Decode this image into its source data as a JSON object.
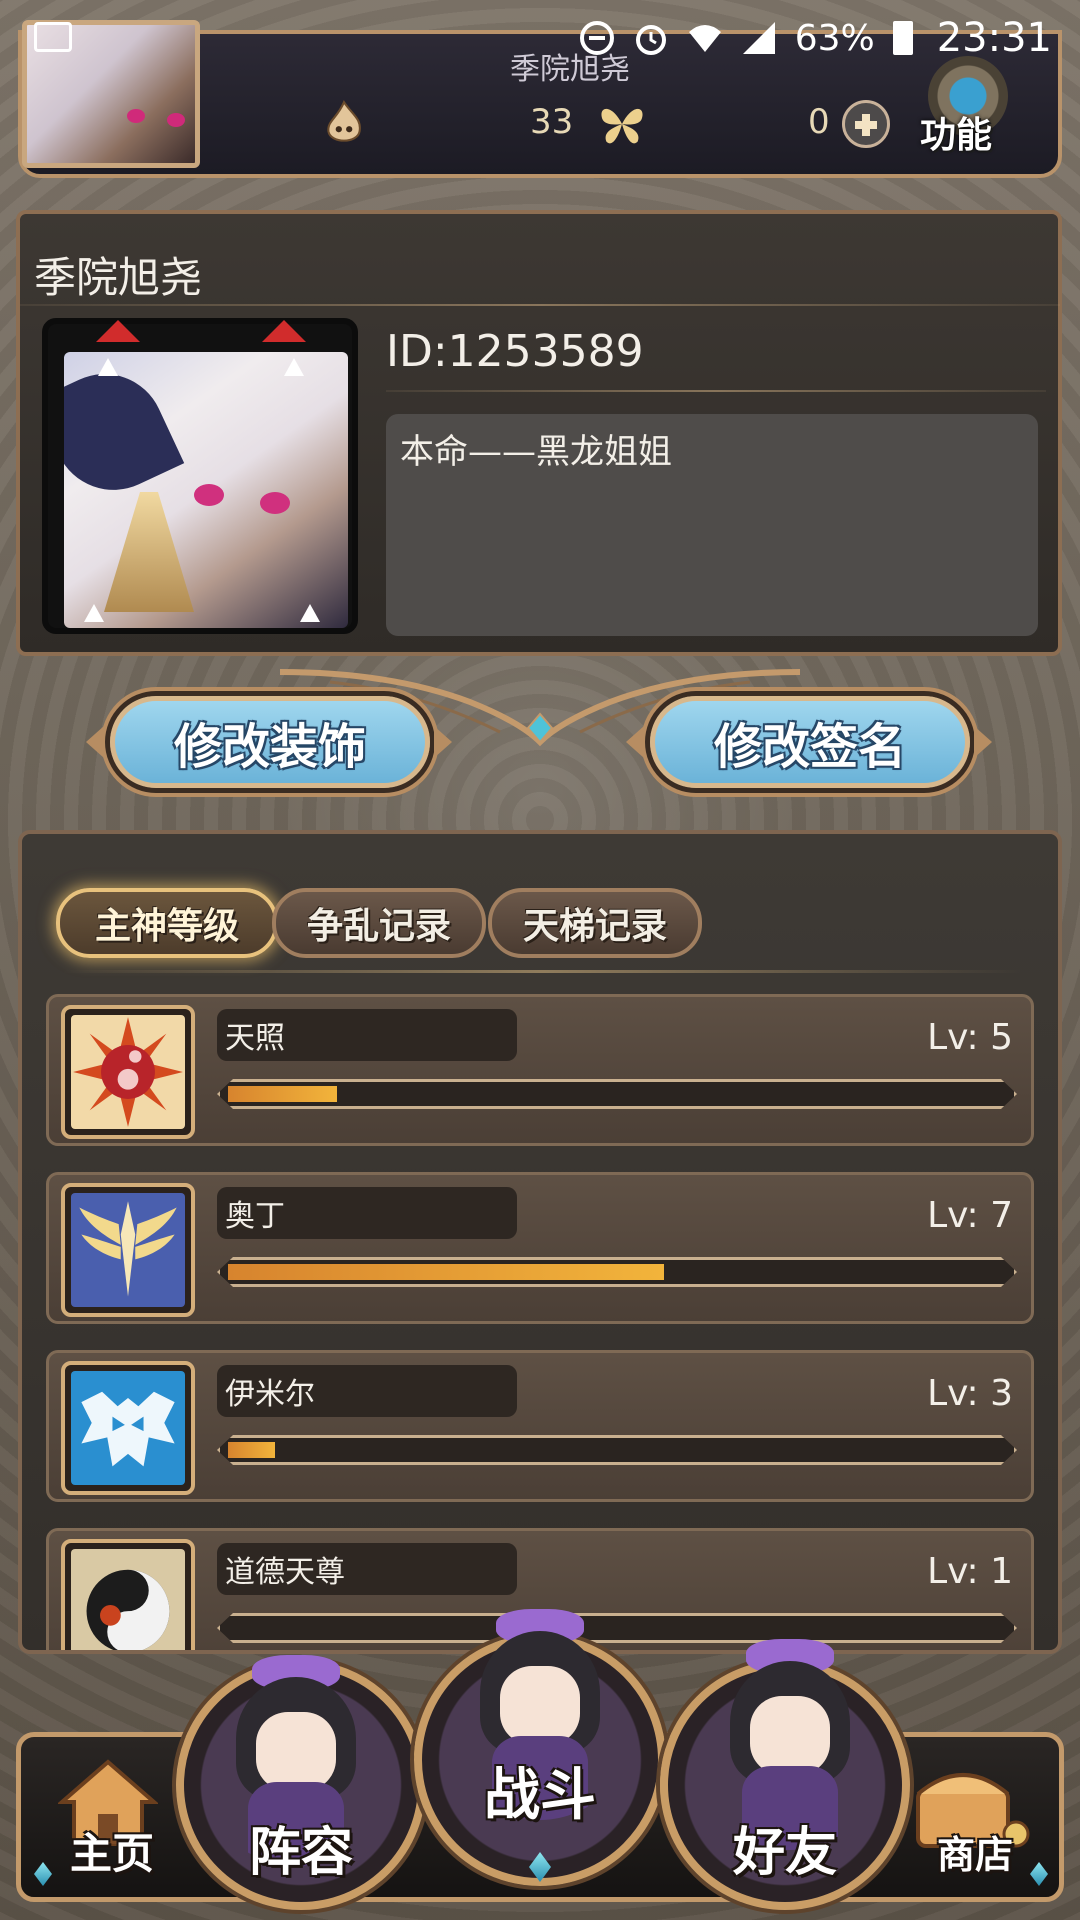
{
  "status_bar": {
    "battery": "63%",
    "time": "23:31",
    "icons": [
      "image-icon",
      "dnd-icon",
      "alarm-icon",
      "wifi-icon",
      "signal-icon",
      "battery-icon"
    ]
  },
  "top_bar": {
    "player_name": "季院旭尧",
    "currency_1_value": "33",
    "currency_2_value": "0",
    "function_label": "功能"
  },
  "profile": {
    "name": "季院旭尧",
    "id_text": "ID:1253589",
    "signature": "本命——黑龙姐姐"
  },
  "actions": {
    "edit_decoration": "修改装饰",
    "edit_signature": "修改签名"
  },
  "tabs": [
    {
      "label": "主神等级",
      "active": true
    },
    {
      "label": "争乱记录",
      "active": false
    },
    {
      "label": "天梯记录",
      "active": false
    }
  ],
  "gods": [
    {
      "name": "天照",
      "level": "Lv: 5",
      "progress": 0.14,
      "icon": "sun-emblem-icon"
    },
    {
      "name": "奥丁",
      "level": "Lv: 7",
      "progress": 0.56,
      "icon": "wing-sword-icon"
    },
    {
      "name": "伊米尔",
      "level": "Lv: 3",
      "progress": 0.06,
      "icon": "ice-skull-icon"
    },
    {
      "name": "道德天尊",
      "level": "Lv: 1",
      "progress": 0.0,
      "icon": "yin-yang-icon"
    }
  ],
  "bottom_nav": {
    "home": "主页",
    "lineup": "阵容",
    "battle": "战斗",
    "friends": "好友",
    "shop": "商店"
  },
  "colors": {
    "accent_gold": "#c9a06b",
    "button_blue": "#7fc3e3",
    "progress_orange": "#f2b43b"
  }
}
